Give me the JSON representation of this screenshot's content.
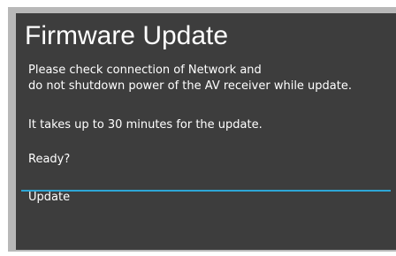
{
  "dialog": {
    "title": "Firmware Update",
    "message_line1": "Please check connection of Network and",
    "message_line2": "do not shutdown power of the AV receiver while update.",
    "duration_note": "It takes up to 30 minutes for the update.",
    "prompt": "Ready?",
    "actions": [
      {
        "label": "Update",
        "selected": true
      }
    ],
    "colors": {
      "panel_background": "#3d3d3d",
      "frame_border": "#b8b8b8",
      "text": "#ffffff",
      "selection_accent": "#2ea6d6"
    }
  }
}
